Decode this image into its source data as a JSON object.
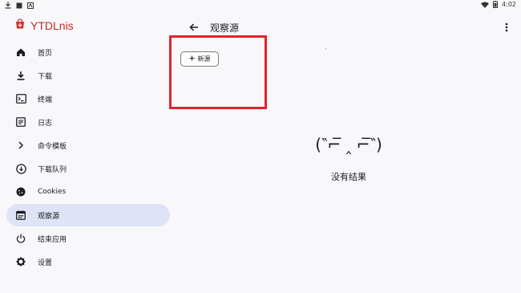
{
  "status_bar": {
    "time": "4:02"
  },
  "app": {
    "title": "YTDLnis"
  },
  "sidebar": {
    "items": [
      {
        "label": "首页",
        "icon": "home-icon"
      },
      {
        "label": "下载",
        "icon": "download-icon"
      },
      {
        "label": "终端",
        "icon": "terminal-icon"
      },
      {
        "label": "日志",
        "icon": "log-icon"
      },
      {
        "label": "命令模板",
        "icon": "chevron-right-icon"
      },
      {
        "label": "下载队列",
        "icon": "download-queue-icon"
      },
      {
        "label": "Cookies",
        "icon": "cookie-icon"
      },
      {
        "label": "观察源",
        "icon": "calendar-icon",
        "active": true
      },
      {
        "label": "结束应用",
        "icon": "power-icon"
      },
      {
        "label": "设置",
        "icon": "gear-icon"
      }
    ]
  },
  "header": {
    "title": "观察源"
  },
  "actions": {
    "new_source_label": "新源"
  },
  "empty_state": {
    "face": "(‶⌐̅ ‸ ⌐̅‶)",
    "message": "没有结果"
  },
  "colors": {
    "brand": "#c62828",
    "active_bg": "#dfe3f7",
    "highlight": "#e0242c"
  }
}
